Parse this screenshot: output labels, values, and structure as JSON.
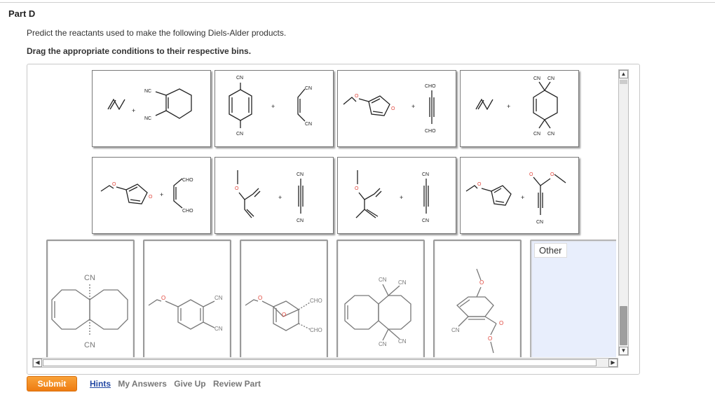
{
  "part": {
    "title": "Part D"
  },
  "prompt": "Predict the reactants used to make the following Diels-Alder products.",
  "instruction": "Drag the appropriate conditions to their respective bins.",
  "labels": {
    "cn": "CN",
    "nc": "NC",
    "cho": "CHO",
    "plus": "+",
    "o": "O"
  },
  "bins": {
    "other_label": "Other"
  },
  "footer": {
    "submit": "Submit",
    "hints": "Hints",
    "my_answers": "My Answers",
    "give_up": "Give Up",
    "review_part": "Review Part"
  },
  "colors": {
    "accent": "#f08a1c",
    "oxygen": "#e0443a",
    "bin_other_bg": "#e8eefc",
    "link": "#2247a3"
  }
}
